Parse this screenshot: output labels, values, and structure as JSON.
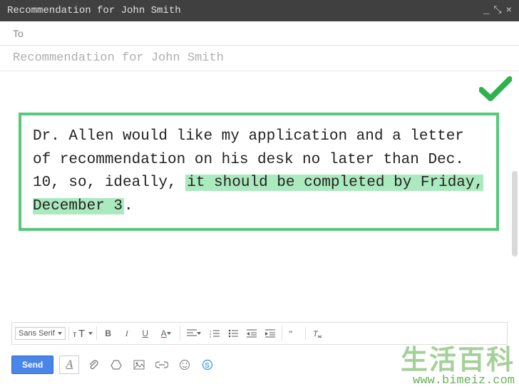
{
  "window": {
    "title": "Recommendation for John Smith"
  },
  "compose": {
    "to_label": "To",
    "subject_placeholder": "Recommendation for John Smith",
    "body": {
      "plain_before": "Dr. Allen would like my application and a letter of recommendation on his desk no later than Dec. 10, so, ideally, ",
      "highlighted": "it should be completed by Friday, December 3",
      "plain_after": "."
    }
  },
  "toolbar": {
    "font_family": "Sans Serif",
    "send_label": "Send"
  },
  "watermark": {
    "cjk": "生活百科",
    "url": "www.bimeiz.com"
  }
}
